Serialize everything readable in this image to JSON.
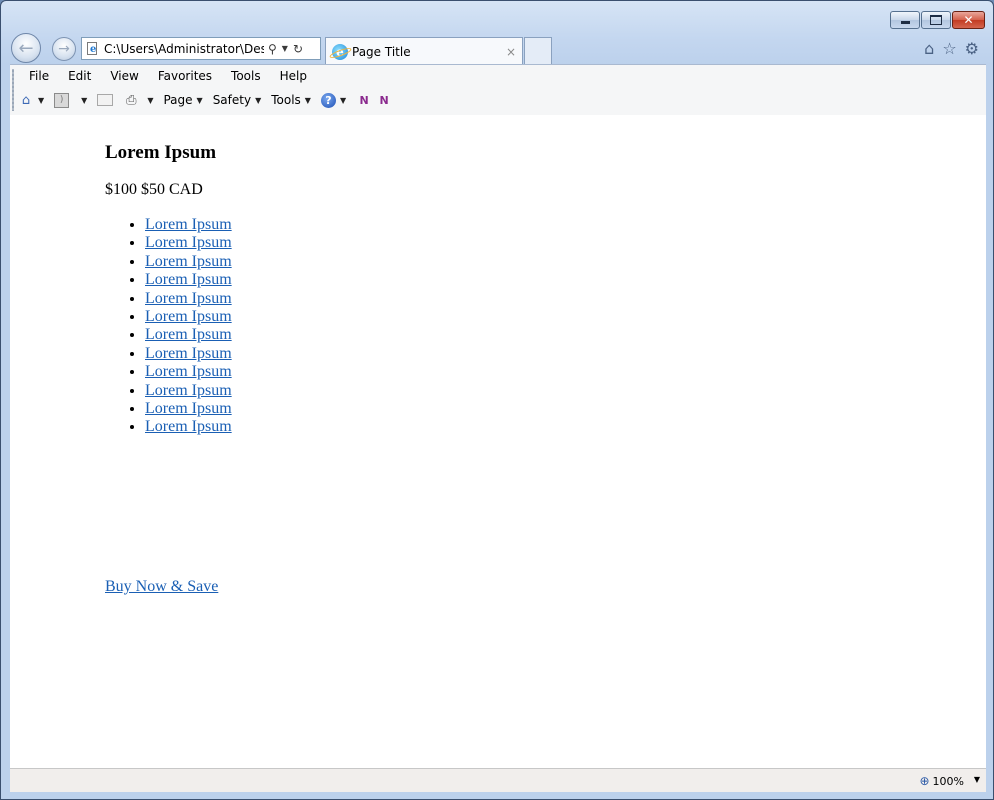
{
  "window": {
    "caption_buttons": [
      "minimize",
      "maximize",
      "close"
    ]
  },
  "nav": {
    "address_value": "C:\\Users\\Administrator\\Desktop",
    "tab_title": "Page Title",
    "tab_close": "×"
  },
  "menu": {
    "items": [
      "File",
      "Edit",
      "View",
      "Favorites",
      "Tools",
      "Help"
    ]
  },
  "command_bar": {
    "page_label": "Page",
    "safety_label": "Safety",
    "tools_label": "Tools"
  },
  "content": {
    "heading": "Lorem Ipsum",
    "price": "$100 $50 CAD",
    "links": [
      "Lorem Ipsum",
      "Lorem Ipsum",
      "Lorem Ipsum",
      "Lorem Ipsum",
      "Lorem Ipsum",
      "Lorem Ipsum",
      "Lorem Ipsum",
      "Lorem Ipsum",
      "Lorem Ipsum",
      "Lorem Ipsum",
      "Lorem Ipsum",
      "Lorem Ipsum"
    ],
    "buy_link": "Buy Now & Save"
  },
  "status": {
    "zoom": "100%"
  },
  "colors": {
    "link": "#1a5fb4",
    "frame": "#bcd1ec",
    "close_button": "#c23b22"
  }
}
